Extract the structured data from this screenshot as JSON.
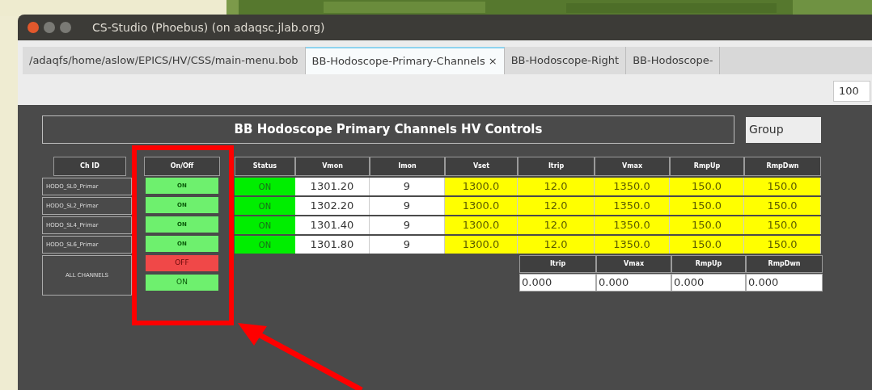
{
  "window": {
    "title": "CS-Studio (Phoebus) (on adaqsc.jlab.org)"
  },
  "tabs": [
    {
      "label": "/adaqfs/home/aslow/EPICS/HV/CSS/main-menu.bob",
      "selected": false
    },
    {
      "label": "BB-Hodoscope-Primary-Channels",
      "close": "×",
      "selected": true
    },
    {
      "label": "BB-Hodoscope-Right",
      "selected": false
    },
    {
      "label": "BB-Hodoscope-",
      "selected": false
    }
  ],
  "toolbar": {
    "zoom": "100"
  },
  "panel": {
    "title": "BB Hodoscope Primary Channels HV Controls",
    "group_field": "Group"
  },
  "table": {
    "columns": [
      "Ch ID",
      "On/Off",
      "Status",
      "Vmon",
      "Imon",
      "Vset",
      "Itrip",
      "Vmax",
      "RmpUp",
      "RmpDwn"
    ],
    "rows": [
      {
        "ch_id": "HODO_SL0_Primar",
        "on_off": "ON",
        "on": true,
        "status": "ON",
        "vmon": "1301.20",
        "imon": "9",
        "vset": "1300.0",
        "itrip": "12.0",
        "vmax": "1350.0",
        "rmpup": "150.0",
        "rmpdwn": "150.0"
      },
      {
        "ch_id": "HODO_SL2_Primar",
        "on_off": "ON",
        "on": true,
        "status": "ON",
        "vmon": "1302.20",
        "imon": "9",
        "vset": "1300.0",
        "itrip": "12.0",
        "vmax": "1350.0",
        "rmpup": "150.0",
        "rmpdwn": "150.0"
      },
      {
        "ch_id": "HODO_SL4_Primar",
        "on_off": "ON",
        "on": true,
        "status": "ON",
        "vmon": "1301.40",
        "imon": "9",
        "vset": "1300.0",
        "itrip": "12.0",
        "vmax": "1350.0",
        "rmpup": "150.0",
        "rmpdwn": "150.0"
      },
      {
        "ch_id": "HODO_SL6_Primar",
        "on_off": "ON",
        "on": true,
        "status": "ON",
        "vmon": "1301.80",
        "imon": "9",
        "vset": "1300.0",
        "itrip": "12.0",
        "vmax": "1350.0",
        "rmpup": "150.0",
        "rmpdwn": "150.0"
      }
    ]
  },
  "all_channels": {
    "label": "ALL CHANNELS",
    "buttons": [
      {
        "label": "OFF",
        "kind": "off"
      },
      {
        "label": "ON",
        "kind": "on"
      }
    ],
    "settings": [
      {
        "label": "Itrip",
        "value": "0.000"
      },
      {
        "label": "Vmax",
        "value": "0.000"
      },
      {
        "label": "RmpUp",
        "value": "0.000"
      },
      {
        "label": "RmpDwn",
        "value": "0.000"
      }
    ]
  }
}
